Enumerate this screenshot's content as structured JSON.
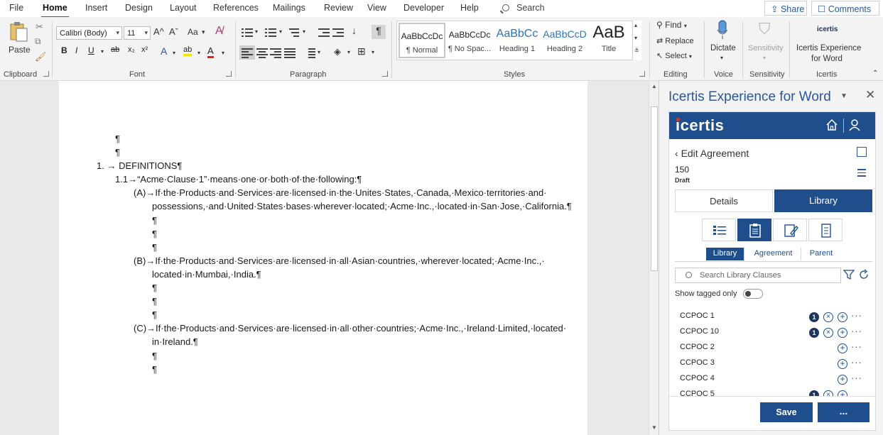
{
  "menu": {
    "tabs": [
      "File",
      "Home",
      "Insert",
      "Design",
      "Layout",
      "References",
      "Mailings",
      "Review",
      "View",
      "Developer",
      "Help"
    ],
    "active_tab": "Home",
    "search_label": "Search",
    "share_label": "Share",
    "comments_label": "Comments"
  },
  "ribbon": {
    "clipboard": {
      "paste_label": "Paste",
      "group_label": "Clipboard"
    },
    "font": {
      "font_name": "Calibri (Body)",
      "font_size": "11",
      "group_label": "Font",
      "bold": "B",
      "italic": "I",
      "underline": "U",
      "strike": "ab",
      "subscript": "x₂",
      "superscript": "x²",
      "grow": "A^",
      "shrink": "Aˇ",
      "case": "Aa",
      "effects": "A",
      "highlight": "ab",
      "font_color": "A"
    },
    "paragraph": {
      "group_label": "Paragraph",
      "show_marks": "¶"
    },
    "styles": {
      "group_label": "Styles",
      "items": [
        {
          "preview": "AaBbCcDc",
          "name": "¶ Normal"
        },
        {
          "preview": "AaBbCcDc",
          "name": "¶ No Spac..."
        },
        {
          "preview": "AaBbCc",
          "name": "Heading 1"
        },
        {
          "preview": "AaBbCcD",
          "name": "Heading 2"
        },
        {
          "preview": "AaB",
          "name": "Title"
        }
      ]
    },
    "editing": {
      "group_label": "Editing",
      "find": "Find",
      "replace": "Replace",
      "select": "Select"
    },
    "voice": {
      "dictate": "Dictate",
      "group_label": "Voice"
    },
    "sensitivity": {
      "label": "Sensitivity",
      "group_label": "Sensitivity"
    },
    "icertis": {
      "logo": "icertis",
      "label_line1": "Icertis Experience",
      "label_line2": "for Word",
      "group_label": "Icertis"
    }
  },
  "document": {
    "lines": [
      "¶",
      "¶",
      "1. → DEFINITIONS¶",
      "1.1→“Acme·Clause·1”·means·one·or·both·of·the·following:¶",
      "(A)→If·the·Products·and·Services·are·licensed·in·the·Unites·States,·Canada,·Mexico·territories·and·",
      "possessions,·and·United·States·bases·wherever·located;·Acme·Inc.,·located·in·San·Jose,·California.¶",
      "¶",
      "¶",
      "¶",
      "(B)→If·the·Products·and·Services·are·licensed·in·all·Asian·countries,·wherever·located;·Acme·Inc.,·",
      "located·in·Mumbai,·India.¶",
      "¶",
      "¶",
      "¶",
      "(C)→If·the·Products·and·Services·are·licensed·in·all·other·countries;·Acme·Inc.,·Ireland·Limited,·located·",
      "in·Ireland.¶",
      "¶",
      "¶"
    ]
  },
  "pane": {
    "title": "Icertis Experience for Word",
    "addin": {
      "logo": "icertis",
      "edit_agreement": "Edit Agreement",
      "agreement_number": "150",
      "status": "Draft",
      "tabs": [
        "Details",
        "Library"
      ],
      "active_tab": "Library",
      "sub_tabs": [
        "Library",
        "Agreement",
        "Parent"
      ],
      "search_placeholder": "Search Library Clauses",
      "show_tagged_label": "Show tagged only",
      "clauses": [
        {
          "name": "CCPOC 1",
          "count": "1",
          "tagged": true
        },
        {
          "name": "CCPOC 10",
          "count": "1",
          "tagged": true
        },
        {
          "name": "CCPOC 2",
          "count": "",
          "tagged": false
        },
        {
          "name": "CCPOC 3",
          "count": "",
          "tagged": false
        },
        {
          "name": "CCPOC 4",
          "count": "",
          "tagged": false
        },
        {
          "name": "CCPOC 5",
          "count": "1",
          "tagged": true
        }
      ],
      "save_label": "Save",
      "more_label": "..."
    }
  },
  "colors": {
    "word_blue": "#2b579a",
    "icertis_navy": "#1e4f8c",
    "badge": "#1e3461"
  }
}
